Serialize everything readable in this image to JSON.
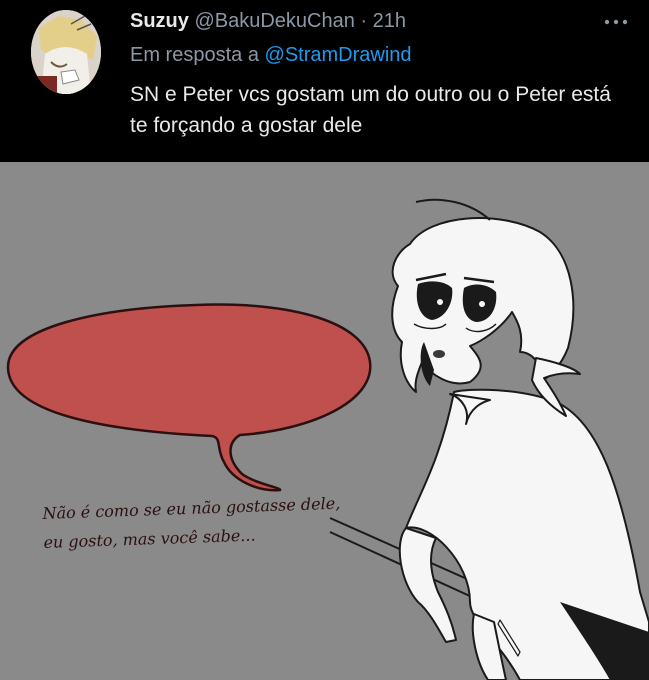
{
  "tweet": {
    "display_name": "Suzuy",
    "handle": "@BakuDekuChan",
    "separator": "·",
    "time": "21h",
    "reply_prefix": "Em resposta a",
    "reply_mention": "@StramDrawind",
    "text": "SN e Peter vcs gostam um do outro ou o Peter está te forçando a gostar dele",
    "more_icon": "more-dots-icon"
  },
  "comic": {
    "speech_line_1": "Não é como se eu não gostasse dele,",
    "speech_line_2": "eu gosto, mas você sabe...",
    "colors": {
      "background": "#8a8a8a",
      "bubble": "#c0504d",
      "skin": "#f7f7f7"
    }
  }
}
